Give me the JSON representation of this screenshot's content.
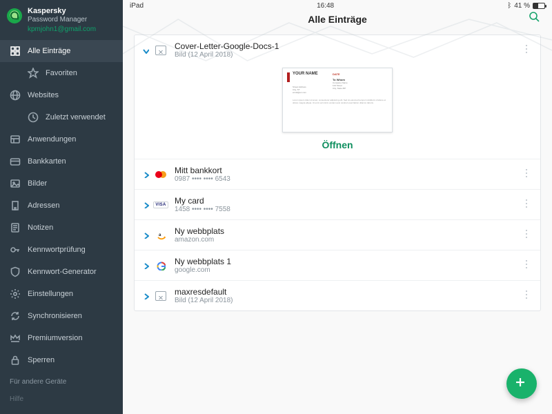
{
  "statusbar": {
    "device": "iPad",
    "wifi": true,
    "time": "16:48",
    "bluetooth": true,
    "battery_pct": "41 %"
  },
  "brand": {
    "title": "Kaspersky",
    "subtitle": "Password Manager",
    "email": "kpmjohn1@gmail.com"
  },
  "sidebar": {
    "items": [
      {
        "label": "Alle Einträge",
        "icon": "grid"
      },
      {
        "label": "Favoriten",
        "icon": "star",
        "indent": true
      },
      {
        "label": "Websites",
        "icon": "globe"
      },
      {
        "label": "Zuletzt verwendet",
        "icon": "clock",
        "indent": true
      },
      {
        "label": "Anwendungen",
        "icon": "apps"
      },
      {
        "label": "Bankkarten",
        "icon": "card"
      },
      {
        "label": "Bilder",
        "icon": "image"
      },
      {
        "label": "Adressen",
        "icon": "building"
      },
      {
        "label": "Notizen",
        "icon": "note"
      },
      {
        "label": "Kennwortprüfung",
        "icon": "key"
      },
      {
        "label": "Kennwort-Generator",
        "icon": "shield"
      },
      {
        "label": "Einstellungen",
        "icon": "gear"
      },
      {
        "label": "Synchronisieren",
        "icon": "sync"
      },
      {
        "label": "Premiumversion",
        "icon": "crown"
      },
      {
        "label": "Sperren",
        "icon": "lock"
      }
    ],
    "other_devices": "Für andere Geräte",
    "help": "Hilfe"
  },
  "header": {
    "title": "Alle Einträge"
  },
  "entries": [
    {
      "kind": "image",
      "title": "Cover-Letter-Google-Docs-1",
      "sub": "Bild (12 April 2018)",
      "expanded": true,
      "open_label": "Öffnen",
      "thumb": {
        "name_label": "YOUR NAME",
        "date_label": "DATE",
        "to_label": "To Whom"
      }
    },
    {
      "kind": "card-mastercard",
      "title": "Mitt bankkort",
      "sub": "0987 •••• •••• 6543"
    },
    {
      "kind": "card-visa",
      "title": "My card",
      "sub": "1458 •••• •••• 7558"
    },
    {
      "kind": "site-amazon",
      "title": "Ny webbplats",
      "sub": "amazon.com"
    },
    {
      "kind": "site-google",
      "title": "Ny webbplats 1",
      "sub": "google.com"
    },
    {
      "kind": "image",
      "title": "maxresdefault",
      "sub": "Bild (12 April 2018)"
    }
  ]
}
